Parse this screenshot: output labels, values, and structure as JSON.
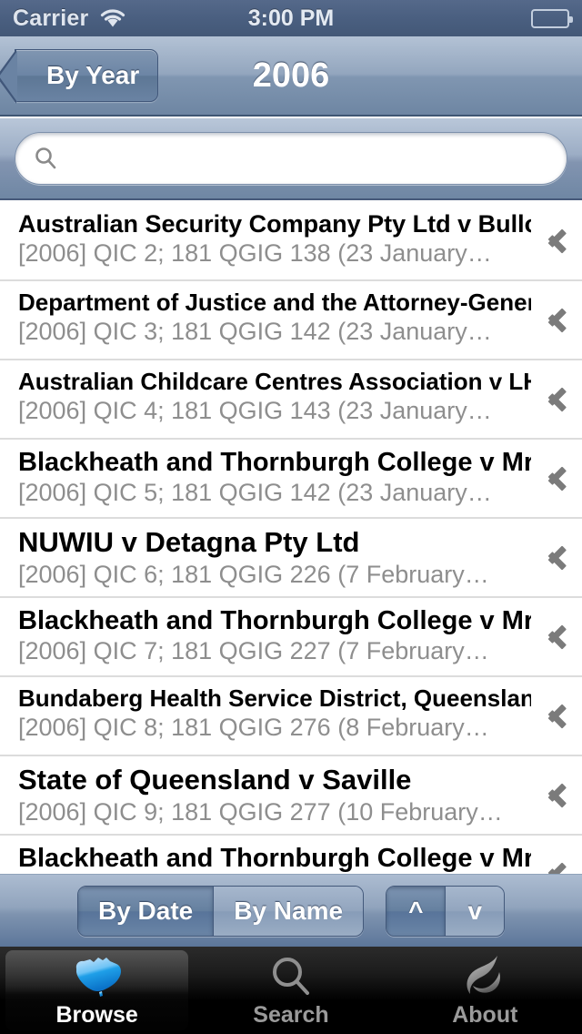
{
  "status_bar": {
    "carrier": "Carrier",
    "time": "3:00 PM",
    "wifi_icon": "wifi-icon",
    "battery_icon": "battery-icon"
  },
  "nav_bar": {
    "back_label": "By Year",
    "title": "2006"
  },
  "search": {
    "value": "",
    "placeholder": "",
    "icon": "search-icon"
  },
  "list": {
    "rows": [
      {
        "title": "Australian Security Company Pty Ltd v Bullock",
        "subtitle": "[2006] QIC 2; 181 QGIG 138 (23 January…",
        "title_size": "27px"
      },
      {
        "title": "Department of Justice and the Attorney-General…",
        "subtitle": "[2006] QIC 3; 181 QGIG 142 (23 January…",
        "title_size": "26px"
      },
      {
        "title": "Australian Childcare Centres Association v LHMU",
        "subtitle": "[2006] QIC 4; 181 QGIG 143 (23 January…",
        "title_size": "26px"
      },
      {
        "title": "Blackheath and Thornburgh College v Mr AA",
        "subtitle": "[2006] QIC 5; 181 QGIG 142 (23 January…",
        "title_size": "29px"
      },
      {
        "title": "NUWIU v Detagna Pty Ltd",
        "subtitle": "[2006] QIC 6; 181 QGIG 226 (7 February…",
        "title_size": "31px"
      },
      {
        "title": "Blackheath and Thornburgh College v Mr AA",
        "subtitle": "[2006] QIC 7; 181 QGIG 227 (7 February…",
        "title_size": "29px"
      },
      {
        "title": "Bundaberg Health Service District, Queensland…",
        "subtitle": "[2006] QIC 8; 181 QGIG 276 (8 February…",
        "title_size": "26px"
      },
      {
        "title": "State of Queensland v Saville",
        "subtitle": "[2006] QIC 9; 181 QGIG 277 (10 February…",
        "title_size": "31px"
      },
      {
        "title": "Blackheath and Thornburgh College v Mr AA",
        "subtitle": "",
        "title_size": "29px"
      }
    ],
    "disclosure_icon": "chevron-right-icon"
  },
  "toolbar": {
    "sort_segments": [
      {
        "label": "By Date",
        "selected": true
      },
      {
        "label": "By Name",
        "selected": false
      }
    ],
    "order_segments": [
      {
        "label": "^",
        "selected": true
      },
      {
        "label": "v",
        "selected": false
      }
    ]
  },
  "tab_bar": {
    "tabs": [
      {
        "label": "Browse",
        "icon": "australia-map-icon",
        "selected": true
      },
      {
        "label": "Search",
        "icon": "search-icon",
        "selected": false
      },
      {
        "label": "About",
        "icon": "swirl-logo-icon",
        "selected": false
      }
    ]
  },
  "colors": {
    "status_bar": "#4a5f80",
    "nav_bar": "#8096b1",
    "accent": "#2e9be0",
    "row_title": "#000000",
    "row_subtitle": "#8e8e8e",
    "tab_bar": "#000000"
  }
}
